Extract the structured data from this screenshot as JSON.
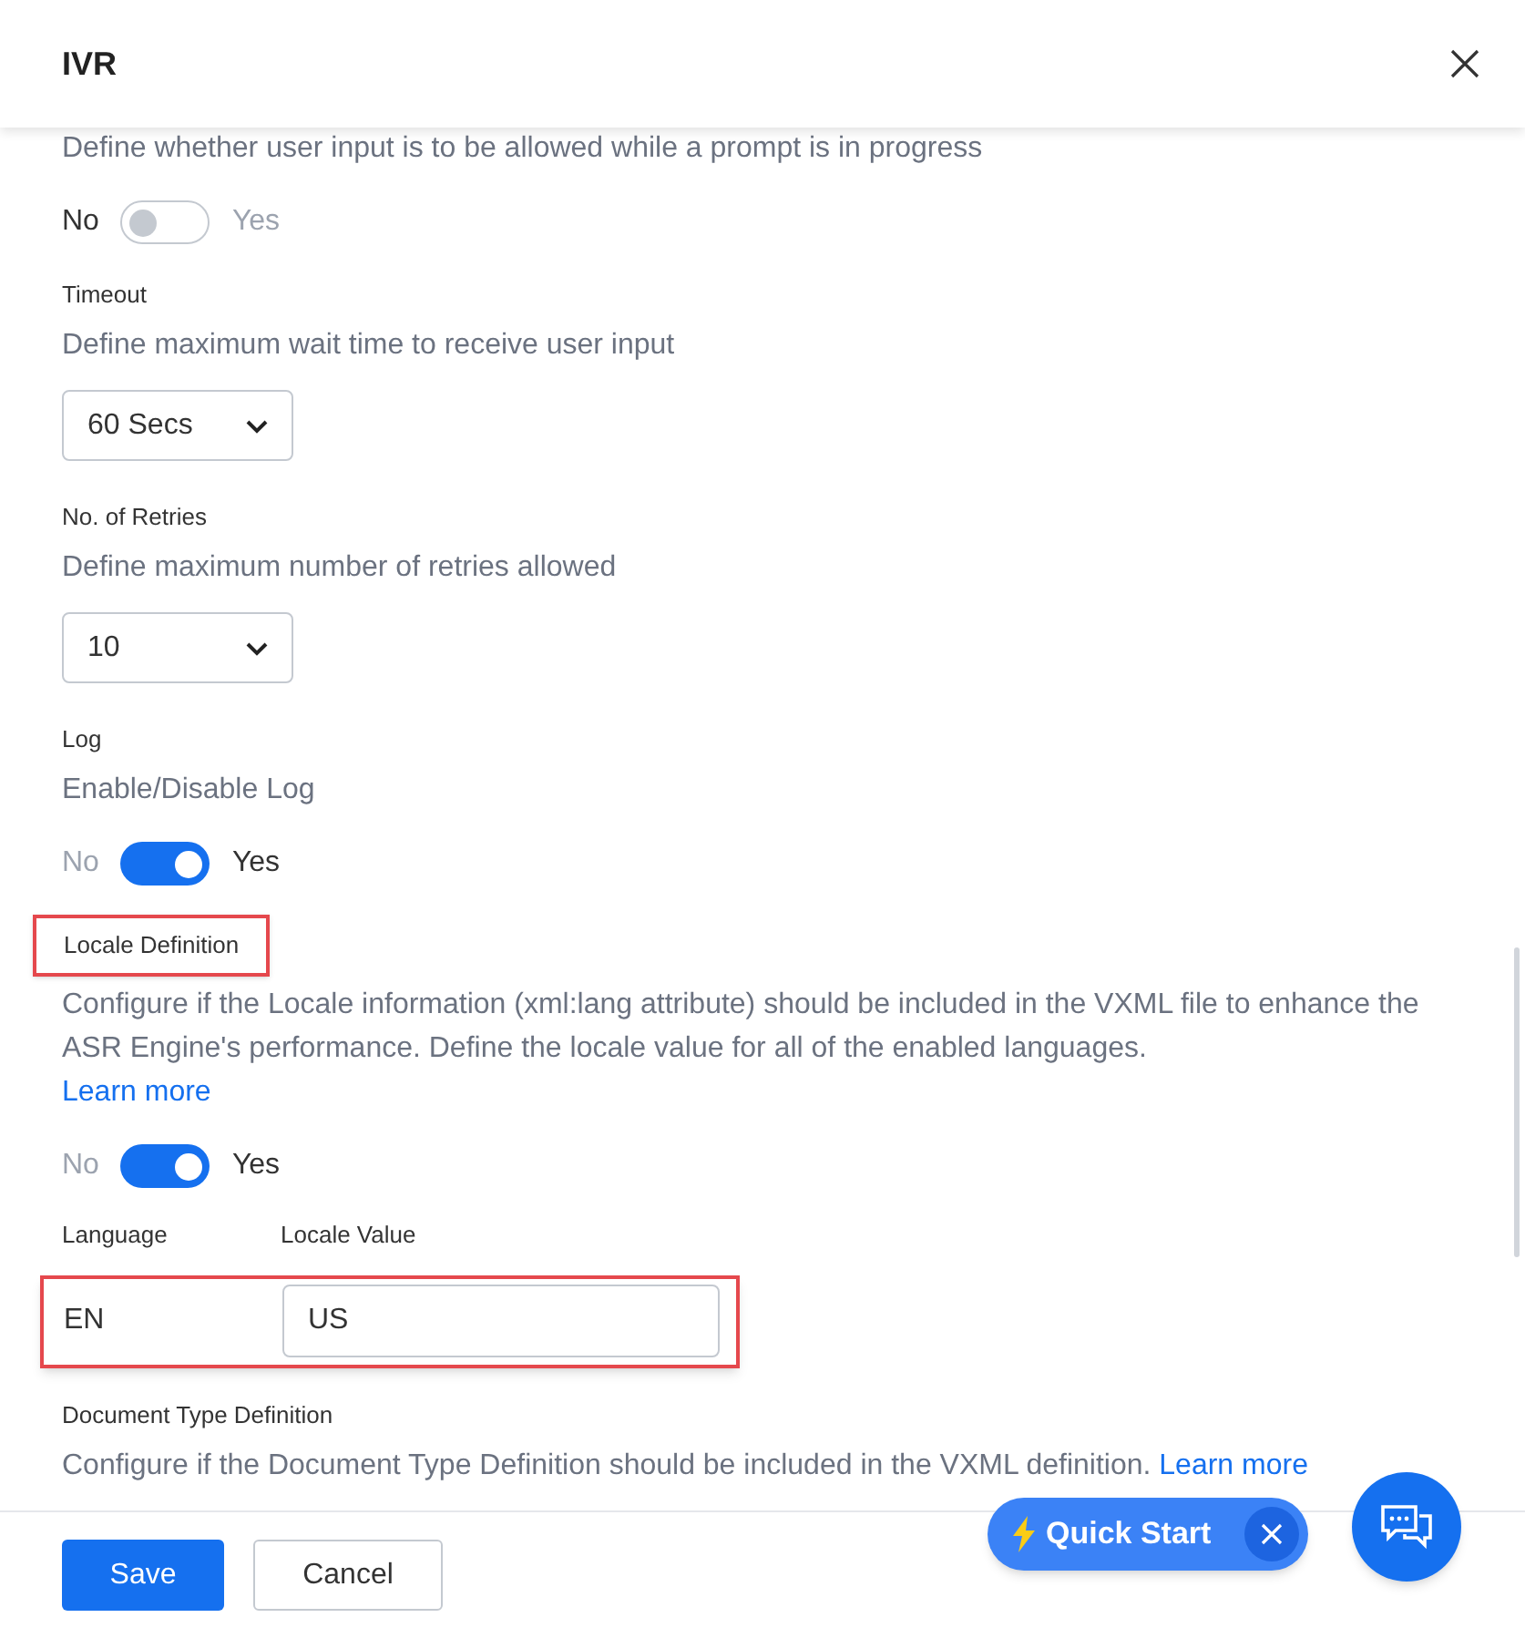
{
  "dialog": {
    "title": "IVR"
  },
  "sections": [
    {
      "kind": "toggle",
      "description": "Define whether user input is to be allowed while a prompt is in progress",
      "off_label": "No",
      "on_label": "Yes",
      "on": false
    },
    {
      "kind": "select",
      "label": "Timeout",
      "description": "Define maximum wait time to receive user input",
      "value": "60 Secs"
    },
    {
      "kind": "select",
      "label": "No. of Retries",
      "description": "Define maximum number of retries allowed",
      "value": "10"
    },
    {
      "kind": "toggle",
      "label": "Log",
      "description": "Enable/Disable Log",
      "off_label": "No",
      "on_label": "Yes",
      "on": true
    },
    {
      "kind": "toggle",
      "label": "Locale Definition",
      "highlighted": true,
      "description": "Configure if the Locale information (xml:lang attribute) should be included in the VXML file to enhance the ASR Engine's performance. Define the locale value for all of the enabled languages.",
      "link": "Learn more",
      "off_label": "No",
      "on_label": "Yes",
      "on": true
    },
    {
      "kind": "locale_table",
      "columns": [
        "Language",
        "Locale Value"
      ],
      "rows": [
        {
          "language": "EN",
          "value": "US",
          "highlighted": true
        }
      ]
    },
    {
      "kind": "text",
      "label": "Document Type Definition",
      "description": "Configure if the Document Type Definition should be included in the VXML definition.",
      "link": "Learn more"
    }
  ],
  "footer": {
    "buttons": [
      "Save",
      "Cancel"
    ]
  },
  "quick_start": {
    "label": "Quick Start"
  }
}
